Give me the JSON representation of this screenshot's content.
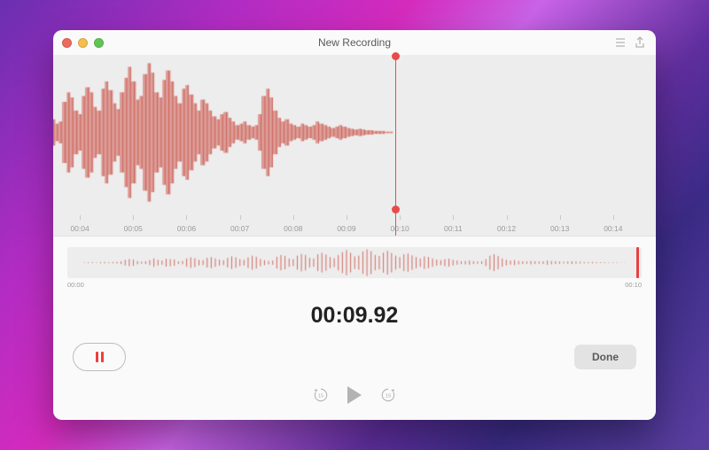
{
  "window_title": "New Recording",
  "current_time": "00:09.92",
  "duration_seconds": 10.0,
  "playhead_seconds": 9.92,
  "buttons": {
    "done": "Done"
  },
  "skip": {
    "back_text": "15",
    "forward_text": "15"
  },
  "ruler_ticks": [
    "00:04",
    "00:05",
    "00:06",
    "00:07",
    "00:08",
    "00:09",
    "00:10",
    "00:11",
    "00:12",
    "00:13",
    "00:14"
  ],
  "ruler_visible_start_seconds": 3.5,
  "ruler_visible_end_seconds": 14.8,
  "overview_labels": {
    "start": "00:00",
    "end": "00:10"
  },
  "waveform_color": "#d06a62",
  "playhead_color": "#e94b4b",
  "waveform_amplitudes": [
    0.0,
    0.0,
    0.0,
    0.0,
    0.02,
    0.03,
    0.03,
    0.02,
    0.04,
    0.05,
    0.03,
    0.05,
    0.06,
    0.1,
    0.2,
    0.25,
    0.22,
    0.12,
    0.08,
    0.1,
    0.18,
    0.3,
    0.2,
    0.15,
    0.28,
    0.25,
    0.22,
    0.1,
    0.12,
    0.3,
    0.38,
    0.32,
    0.2,
    0.18,
    0.35,
    0.4,
    0.3,
    0.22,
    0.18,
    0.35,
    0.45,
    0.38,
    0.25,
    0.2,
    0.38,
    0.5,
    0.42,
    0.26,
    0.18,
    0.12,
    0.15,
    0.42,
    0.55,
    0.48,
    0.3,
    0.25,
    0.5,
    0.62,
    0.55,
    0.35,
    0.3,
    0.6,
    0.7,
    0.58,
    0.4,
    0.32,
    0.55,
    0.75,
    0.9,
    0.7,
    0.45,
    0.5,
    0.8,
    0.95,
    0.82,
    0.55,
    0.48,
    0.72,
    0.85,
    0.7,
    0.5,
    0.4,
    0.6,
    0.65,
    0.52,
    0.4,
    0.3,
    0.45,
    0.4,
    0.3,
    0.22,
    0.18,
    0.25,
    0.28,
    0.2,
    0.15,
    0.1,
    0.12,
    0.15,
    0.1,
    0.08,
    0.1,
    0.25,
    0.5,
    0.6,
    0.48,
    0.3,
    0.2,
    0.15,
    0.18,
    0.12,
    0.1,
    0.08,
    0.12,
    0.1,
    0.08,
    0.1,
    0.15,
    0.12,
    0.1,
    0.08,
    0.06,
    0.08,
    0.1,
    0.08,
    0.06,
    0.05,
    0.04,
    0.05,
    0.04,
    0.03,
    0.03,
    0.02,
    0.02,
    0.02,
    0.01,
    0.01,
    0.0,
    0.0,
    0.0
  ],
  "icons": {
    "list": "list-icon",
    "share": "share-icon"
  }
}
